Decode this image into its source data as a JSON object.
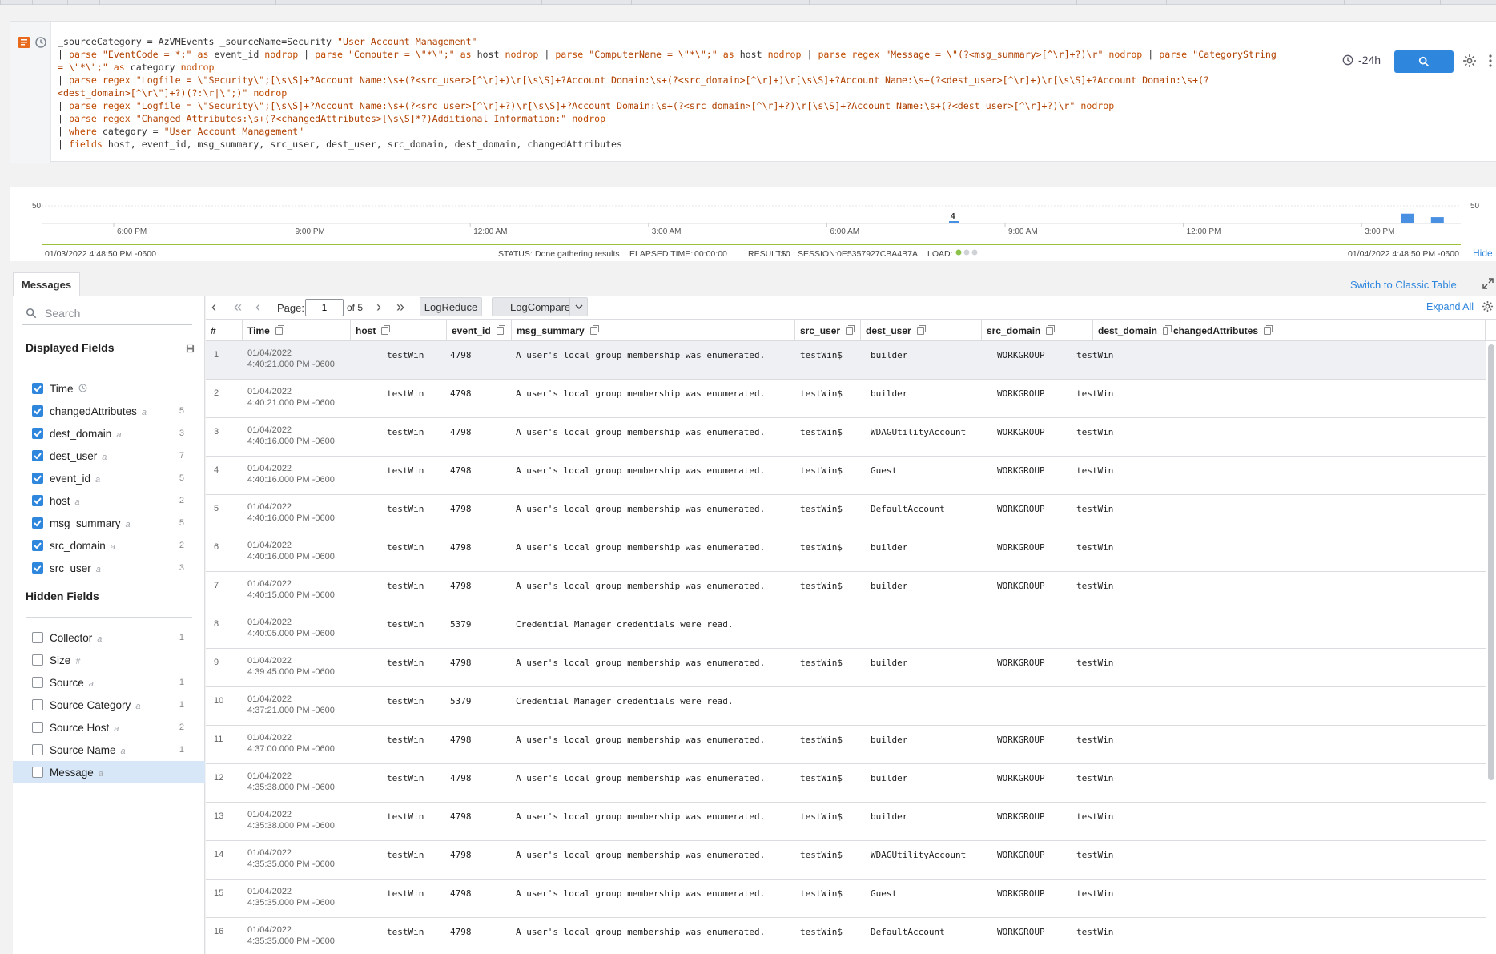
{
  "query": {
    "lines": [
      [
        [
          "t",
          "_sourceCategory = AzVMEvents _sourceName=Security "
        ],
        [
          "s",
          "\"User Account Management\""
        ]
      ],
      [
        [
          "t",
          "| "
        ],
        [
          "k",
          "parse "
        ],
        [
          "s",
          "\"EventCode = *;\""
        ],
        [
          "k",
          " as "
        ],
        [
          "t",
          "event_id "
        ],
        [
          "k",
          "nodrop"
        ],
        [
          "t",
          " | "
        ],
        [
          "k",
          "parse "
        ],
        [
          "s",
          "\"Computer = \\\"*\\\";\""
        ],
        [
          "k",
          " as "
        ],
        [
          "t",
          "host "
        ],
        [
          "k",
          "nodrop"
        ],
        [
          "t",
          " | "
        ],
        [
          "k",
          "parse "
        ],
        [
          "s",
          "\"ComputerName = \\\"*\\\";\""
        ],
        [
          "k",
          " as "
        ],
        [
          "t",
          "host "
        ],
        [
          "k",
          "nodrop"
        ],
        [
          "t",
          " | "
        ],
        [
          "k",
          "parse regex "
        ],
        [
          "s",
          "\"Message = \\\"(?<msg_summary>[^\\r]+?)\\r\" "
        ],
        [
          "k",
          "nodrop"
        ],
        [
          "t",
          " | "
        ],
        [
          "k",
          "parse "
        ],
        [
          "s",
          "\"CategoryString"
        ]
      ],
      [
        [
          "s",
          "= \\\"*\\\";\""
        ],
        [
          "k",
          " as "
        ],
        [
          "t",
          "category "
        ],
        [
          "k",
          "nodrop"
        ]
      ],
      [
        [
          "t",
          "| "
        ],
        [
          "k",
          "parse regex "
        ],
        [
          "s",
          "\"Logfile = \\\"Security\\\";[\\s\\S]+?Account Name:\\s+(?<src_user>[^\\r]+)\\r[\\s\\S]+?Account Domain:\\s+(?<src_domain>[^\\r]+)\\r[\\s\\S]+?Account Name:\\s+(?<dest_user>[^\\r]+)\\r[\\s\\S]+?Account Domain:\\s+(?"
        ]
      ],
      [
        [
          "s",
          "<dest_domain>[^\\r\\\"]+?)(?:\\r|\\\";)\" "
        ],
        [
          "k",
          "nodrop"
        ]
      ],
      [
        [
          "t",
          "| "
        ],
        [
          "k",
          "parse regex "
        ],
        [
          "s",
          "\"Logfile = \\\"Security\\\";[\\s\\S]+?Account Name:\\s+(?<src_user>[^\\r]+?)\\r[\\s\\S]+?Account Domain:\\s+(?<src_domain>[^\\r]+?)\\r[\\s\\S]+?Account Name:\\s+(?<dest_user>[^\\r]+?)\\r\" "
        ],
        [
          "k",
          "nodrop"
        ]
      ],
      [
        [
          "t",
          "| "
        ],
        [
          "k",
          "parse regex "
        ],
        [
          "s",
          "\"Changed Attributes:\\s+(?<changedAttributes>[\\s\\S]*?)Additional Information:\" "
        ],
        [
          "k",
          "nodrop"
        ]
      ],
      [
        [
          "t",
          "| "
        ],
        [
          "k",
          "where "
        ],
        [
          "t",
          "category = "
        ],
        [
          "s",
          "\"User Account Management\""
        ]
      ],
      [
        [
          "t",
          "| "
        ],
        [
          "k",
          "fields "
        ],
        [
          "t",
          "host, event_id, msg_summary, src_user, dest_user, src_domain, dest_domain, changedAttributes"
        ]
      ]
    ],
    "time_range": "-24h"
  },
  "histogram": {
    "y_label_left": "50",
    "y_label_right": "50",
    "marker_value": "4",
    "x_ticks": [
      "6:00 PM",
      "9:00 PM",
      "12:00 AM",
      "3:00 AM",
      "6:00 AM",
      "9:00 AM",
      "12:00 PM",
      "3:00 PM"
    ],
    "bars": [
      {
        "slot": 0.958,
        "value": 31
      },
      {
        "slot": 0.979,
        "value": 20
      }
    ],
    "start_time": "01/03/2022 4:48:50 PM -0600",
    "end_time": "01/04/2022 4:48:50 PM -0600",
    "status_label": "STATUS:",
    "status_value": "Done gathering results",
    "elapsed_label": "ELAPSED TIME:",
    "elapsed_value": "00:00:00",
    "results_label": "RESULTS:",
    "results_value": "110",
    "session_label": "SESSION:",
    "session_value": "0E5357927CBA4B7A",
    "load_label": "LOAD:",
    "hide_label": "Hide"
  },
  "messages_tab": "Messages",
  "switch_classic": "Switch to Classic Table",
  "sidebar": {
    "search_placeholder": "Search",
    "displayed_title": "Displayed Fields",
    "hidden_title": "Hidden Fields",
    "displayed": [
      {
        "name": "Time",
        "type": "",
        "count": ""
      },
      {
        "name": "changedAttributes",
        "type": "a",
        "count": "5"
      },
      {
        "name": "dest_domain",
        "type": "a",
        "count": "3"
      },
      {
        "name": "dest_user",
        "type": "a",
        "count": "7"
      },
      {
        "name": "event_id",
        "type": "a",
        "count": "5"
      },
      {
        "name": "host",
        "type": "a",
        "count": "2"
      },
      {
        "name": "msg_summary",
        "type": "a",
        "count": "5"
      },
      {
        "name": "src_domain",
        "type": "a",
        "count": "2"
      },
      {
        "name": "src_user",
        "type": "a",
        "count": "3"
      }
    ],
    "hidden": [
      {
        "name": "Collector",
        "type": "a",
        "count": "1"
      },
      {
        "name": "Size",
        "type": "#",
        "count": ""
      },
      {
        "name": "Source",
        "type": "a",
        "count": "1"
      },
      {
        "name": "Source Category",
        "type": "a",
        "count": "1"
      },
      {
        "name": "Source Host",
        "type": "a",
        "count": "2"
      },
      {
        "name": "Source Name",
        "type": "a",
        "count": "1"
      },
      {
        "name": "Message",
        "type": "a",
        "count": ""
      }
    ]
  },
  "toolbar": {
    "page_label": "Page:",
    "page_value": "1",
    "page_of": "of 5",
    "logreduce": "LogReduce",
    "logcompare": "LogCompare",
    "expand_all": "Expand All"
  },
  "table": {
    "columns": [
      "#",
      "Time",
      "host",
      "event_id",
      "msg_summary",
      "src_user",
      "dest_user",
      "src_domain",
      "dest_domain",
      "changedAttributes"
    ],
    "rows": [
      [
        "1",
        "01/04/2022",
        "4:40:21.000 PM -0600",
        "testWin",
        "4798",
        "A user's local group membership was enumerated.",
        "testWin$",
        "builder",
        "WORKGROUP",
        "testWin",
        ""
      ],
      [
        "2",
        "01/04/2022",
        "4:40:21.000 PM -0600",
        "testWin",
        "4798",
        "A user's local group membership was enumerated.",
        "testWin$",
        "builder",
        "WORKGROUP",
        "testWin",
        ""
      ],
      [
        "3",
        "01/04/2022",
        "4:40:16.000 PM -0600",
        "testWin",
        "4798",
        "A user's local group membership was enumerated.",
        "testWin$",
        "WDAGUtilityAccount",
        "WORKGROUP",
        "testWin",
        ""
      ],
      [
        "4",
        "01/04/2022",
        "4:40:16.000 PM -0600",
        "testWin",
        "4798",
        "A user's local group membership was enumerated.",
        "testWin$",
        "Guest",
        "WORKGROUP",
        "testWin",
        ""
      ],
      [
        "5",
        "01/04/2022",
        "4:40:16.000 PM -0600",
        "testWin",
        "4798",
        "A user's local group membership was enumerated.",
        "testWin$",
        "DefaultAccount",
        "WORKGROUP",
        "testWin",
        ""
      ],
      [
        "6",
        "01/04/2022",
        "4:40:16.000 PM -0600",
        "testWin",
        "4798",
        "A user's local group membership was enumerated.",
        "testWin$",
        "builder",
        "WORKGROUP",
        "testWin",
        ""
      ],
      [
        "7",
        "01/04/2022",
        "4:40:15.000 PM -0600",
        "testWin",
        "4798",
        "A user's local group membership was enumerated.",
        "testWin$",
        "builder",
        "WORKGROUP",
        "testWin",
        ""
      ],
      [
        "8",
        "01/04/2022",
        "4:40:05.000 PM -0600",
        "testWin",
        "5379",
        "Credential Manager credentials were read.",
        "",
        "",
        "",
        "",
        ""
      ],
      [
        "9",
        "01/04/2022",
        "4:39:45.000 PM -0600",
        "testWin",
        "4798",
        "A user's local group membership was enumerated.",
        "testWin$",
        "builder",
        "WORKGROUP",
        "testWin",
        ""
      ],
      [
        "10",
        "01/04/2022",
        "4:37:21.000 PM -0600",
        "testWin",
        "5379",
        "Credential Manager credentials were read.",
        "",
        "",
        "",
        "",
        ""
      ],
      [
        "11",
        "01/04/2022",
        "4:37:00.000 PM -0600",
        "testWin",
        "4798",
        "A user's local group membership was enumerated.",
        "testWin$",
        "builder",
        "WORKGROUP",
        "testWin",
        ""
      ],
      [
        "12",
        "01/04/2022",
        "4:35:38.000 PM -0600",
        "testWin",
        "4798",
        "A user's local group membership was enumerated.",
        "testWin$",
        "builder",
        "WORKGROUP",
        "testWin",
        ""
      ],
      [
        "13",
        "01/04/2022",
        "4:35:38.000 PM -0600",
        "testWin",
        "4798",
        "A user's local group membership was enumerated.",
        "testWin$",
        "builder",
        "WORKGROUP",
        "testWin",
        ""
      ],
      [
        "14",
        "01/04/2022",
        "4:35:35.000 PM -0600",
        "testWin",
        "4798",
        "A user's local group membership was enumerated.",
        "testWin$",
        "WDAGUtilityAccount",
        "WORKGROUP",
        "testWin",
        ""
      ],
      [
        "15",
        "01/04/2022",
        "4:35:35.000 PM -0600",
        "testWin",
        "4798",
        "A user's local group membership was enumerated.",
        "testWin$",
        "Guest",
        "WORKGROUP",
        "testWin",
        ""
      ],
      [
        "16",
        "01/04/2022",
        "4:35:35.000 PM -0600",
        "testWin",
        "4798",
        "A user's local group membership was enumerated.",
        "testWin$",
        "DefaultAccount",
        "WORKGROUP",
        "testWin",
        ""
      ]
    ]
  },
  "colors": {
    "accent": "#2f86dd",
    "keyword": "#c04a00",
    "bar": "#4a90e2",
    "timeline": "#9bc23a"
  }
}
